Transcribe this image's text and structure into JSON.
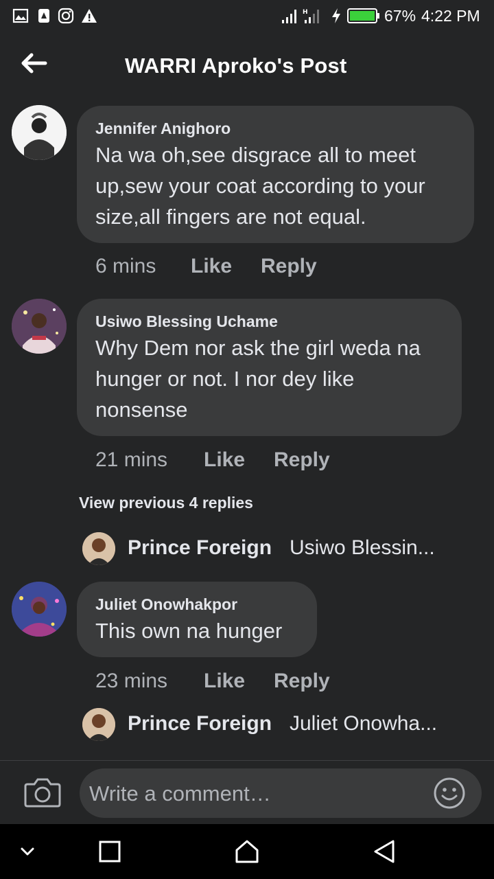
{
  "status_bar": {
    "battery": "67%",
    "time": "4:22 PM"
  },
  "header": {
    "title": "WARRI Aproko's Post"
  },
  "comments": [
    {
      "author": "Jennifer Anighoro",
      "lines": [
        "Na wa oh,see disgrace all to meet",
        "up,sew your coat according to your",
        "size,all fingers are not equal."
      ],
      "time": "6 mins",
      "like": "Like",
      "reply": "Reply"
    },
    {
      "author": "Usiwo Blessing Uchame",
      "lines": [
        "Why Dem nor ask the girl weda na",
        "hunger or not. I nor dey like",
        "nonsense"
      ],
      "time": "21 mins",
      "like": "Like",
      "reply": "Reply",
      "view_previous": "View previous 4 replies",
      "reply_preview": {
        "name": "Prince Foreign",
        "snippet": "Usiwo Blessin..."
      }
    },
    {
      "author": "Juliet Onowhakpor",
      "lines": [
        "This own na hunger"
      ],
      "time": "23 mins",
      "like": "Like",
      "reply": "Reply",
      "reply_preview": {
        "name": "Prince Foreign",
        "snippet": "Juliet Onowha..."
      }
    }
  ],
  "composer": {
    "placeholder": "Write a comment…"
  },
  "icons": {
    "status_left": [
      "image-icon",
      "alert-app-icon",
      "instagram-icon",
      "warning-icon"
    ],
    "status_right": [
      "signal-icon",
      "signal-h-icon",
      "charging-icon",
      "battery-icon"
    ],
    "header": "back-arrow-icon",
    "composer": [
      "camera-icon",
      "emoji-icon"
    ],
    "nav": [
      "chevron-down-icon",
      "recents-square-icon",
      "home-icon",
      "back-triangle-icon"
    ]
  },
  "colors": {
    "background": "#242526",
    "bubble": "#3a3b3c",
    "text": "#e4e6eb",
    "secondary_text": "#b0b3b8",
    "battery": "#3bd13b"
  }
}
